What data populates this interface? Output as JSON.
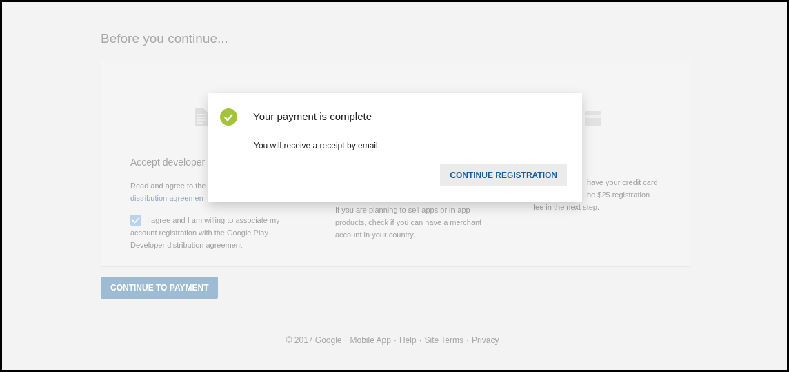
{
  "heading": "Before you continue...",
  "columns": [
    {
      "kind": "agreement",
      "title": "Accept developer",
      "lines": [
        "Read and agree to the",
        "distribution agreemen"
      ],
      "checkbox": {
        "checked": true,
        "label_lines": [
          "I agree and I am willing to associate my",
          "account registration with the Google Play",
          "Developer distribution agreement."
        ]
      }
    },
    {
      "kind": "merchant",
      "lines": [
        "If you are planning to sell apps or in-app",
        "products, check if you can have a merchant",
        "account in your country."
      ]
    },
    {
      "kind": "payment",
      "lines": [
        "have your credit card",
        "he $25 registration",
        "fee in the next step."
      ]
    }
  ],
  "continue_button": {
    "label": "CONTINUE TO PAYMENT",
    "disabled": true
  },
  "footer": {
    "items": [
      "© 2017 Google",
      "Mobile App",
      "Help",
      "Site Terms",
      "Privacy"
    ],
    "separator": "·"
  },
  "dialog": {
    "title": "Your payment is complete",
    "message": "You will receive a receipt by email.",
    "button": "CONTINUE REGISTRATION"
  }
}
